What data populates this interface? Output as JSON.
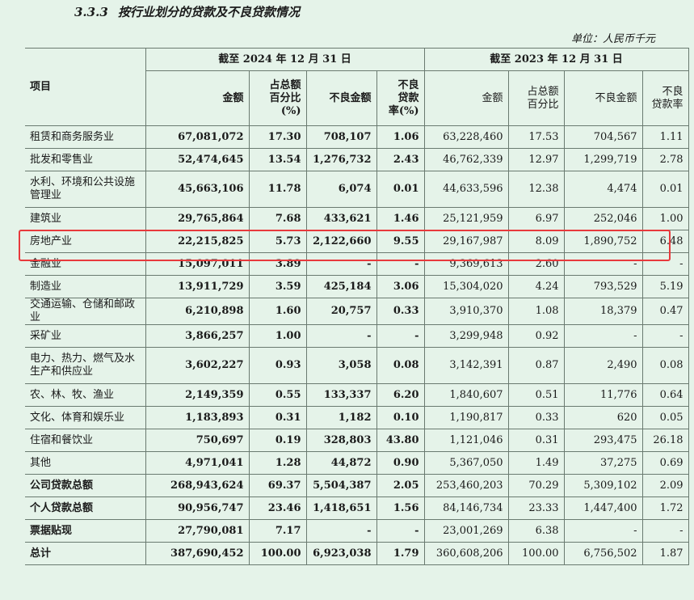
{
  "heading": {
    "number": "3.3.3",
    "title": "按行业划分的贷款及不良贷款情况"
  },
  "unit": "单位：人民币千元",
  "table": {
    "item_header": "项目",
    "period_2024": "截至 2024 年 12 月 31 日",
    "period_2023": "截至 2023 年 12 月 31 日",
    "sub_2024": [
      "金额",
      "占总额\n百分比\n(%)",
      "不良金额",
      "不良\n贷款\n率(%)"
    ],
    "sub_2023": [
      "金额",
      "占总额\n百分比",
      "不良金额",
      "不良\n贷款率"
    ],
    "rows": [
      {
        "label": "租赁和商务服务业",
        "c24": [
          "67,081,072",
          "17.30",
          "708,107",
          "1.06"
        ],
        "c23": [
          "63,228,460",
          "17.53",
          "704,567",
          "1.11"
        ]
      },
      {
        "label": "批发和零售业",
        "c24": [
          "52,474,645",
          "13.54",
          "1,276,732",
          "2.43"
        ],
        "c23": [
          "46,762,339",
          "12.97",
          "1,299,719",
          "2.78"
        ]
      },
      {
        "label": "水利、环境和公共设施管理业",
        "c24": [
          "45,663,106",
          "11.78",
          "6,074",
          "0.01"
        ],
        "c23": [
          "44,633,596",
          "12.38",
          "4,474",
          "0.01"
        ]
      },
      {
        "label": "建筑业",
        "c24": [
          "29,765,864",
          "7.68",
          "433,621",
          "1.46"
        ],
        "c23": [
          "25,121,959",
          "6.97",
          "252,046",
          "1.00"
        ]
      },
      {
        "label": "房地产业",
        "c24": [
          "22,215,825",
          "5.73",
          "2,122,660",
          "9.55"
        ],
        "c23": [
          "29,167,987",
          "8.09",
          "1,890,752",
          "6.48"
        ]
      },
      {
        "label": "金融业",
        "c24": [
          "15,097,011",
          "3.89",
          "-",
          "-"
        ],
        "c23": [
          "9,369,613",
          "2.60",
          "-",
          "-"
        ]
      },
      {
        "label": "制造业",
        "c24": [
          "13,911,729",
          "3.59",
          "425,184",
          "3.06"
        ],
        "c23": [
          "15,304,020",
          "4.24",
          "793,529",
          "5.19"
        ]
      },
      {
        "label": "交通运输、仓储和邮政业",
        "c24": [
          "6,210,898",
          "1.60",
          "20,757",
          "0.33"
        ],
        "c23": [
          "3,910,370",
          "1.08",
          "18,379",
          "0.47"
        ]
      },
      {
        "label": "采矿业",
        "c24": [
          "3,866,257",
          "1.00",
          "-",
          "-"
        ],
        "c23": [
          "3,299,948",
          "0.92",
          "-",
          "-"
        ]
      },
      {
        "label": "电力、热力、燃气及水生产和供应业",
        "c24": [
          "3,602,227",
          "0.93",
          "3,058",
          "0.08"
        ],
        "c23": [
          "3,142,391",
          "0.87",
          "2,490",
          "0.08"
        ]
      },
      {
        "label": "农、林、牧、渔业",
        "c24": [
          "2,149,359",
          "0.55",
          "133,337",
          "6.20"
        ],
        "c23": [
          "1,840,607",
          "0.51",
          "11,776",
          "0.64"
        ]
      },
      {
        "label": "文化、体育和娱乐业",
        "c24": [
          "1,183,893",
          "0.31",
          "1,182",
          "0.10"
        ],
        "c23": [
          "1,190,817",
          "0.33",
          "620",
          "0.05"
        ]
      },
      {
        "label": "住宿和餐饮业",
        "c24": [
          "750,697",
          "0.19",
          "328,803",
          "43.80"
        ],
        "c23": [
          "1,121,046",
          "0.31",
          "293,475",
          "26.18"
        ]
      },
      {
        "label": "其他",
        "c24": [
          "4,971,041",
          "1.28",
          "44,872",
          "0.90"
        ],
        "c23": [
          "5,367,050",
          "1.49",
          "37,275",
          "0.69"
        ]
      },
      {
        "label": "公司贷款总额",
        "c24": [
          "268,943,624",
          "69.37",
          "5,504,387",
          "2.05"
        ],
        "c23": [
          "253,460,203",
          "70.29",
          "5,309,102",
          "2.09"
        ]
      },
      {
        "label": "个人贷款总额",
        "c24": [
          "90,956,747",
          "23.46",
          "1,418,651",
          "1.56"
        ],
        "c23": [
          "84,146,734",
          "23.33",
          "1,447,400",
          "1.72"
        ]
      },
      {
        "label": "票据贴现",
        "c24": [
          "27,790,081",
          "7.17",
          "-",
          "-"
        ],
        "c23": [
          "23,001,269",
          "6.38",
          "-",
          "-"
        ]
      },
      {
        "label": "总计",
        "c24": [
          "387,690,452",
          "100.00",
          "6,923,038",
          "1.79"
        ],
        "c23": [
          "360,608,206",
          "100.00",
          "6,756,502",
          "1.87"
        ]
      }
    ]
  },
  "colors": {
    "background": "#e5f3e9",
    "highlight_box": "#e8393c",
    "grid": "#6a7a70"
  }
}
